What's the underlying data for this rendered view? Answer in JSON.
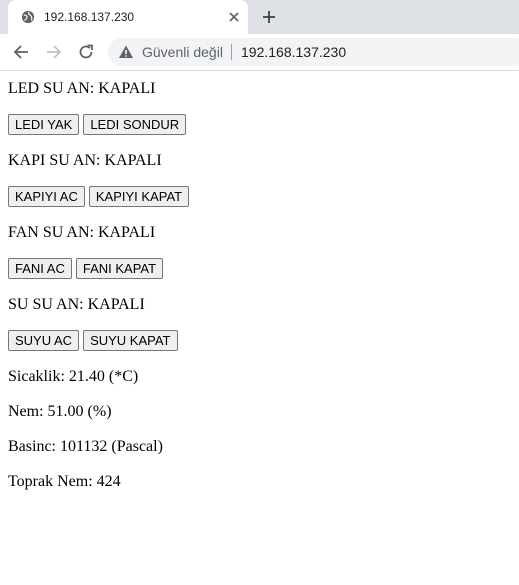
{
  "browser": {
    "tab_title": "192.168.137.230",
    "security_label": "Güvenli değil",
    "url": "192.168.137.230",
    "icons": [
      "globe-icon",
      "close-icon",
      "plus-icon",
      "back-arrow-icon",
      "forward-arrow-icon",
      "reload-icon",
      "warning-icon"
    ]
  },
  "page": {
    "led_status": "LED SU AN: KAPALI",
    "led_on": "LEDI YAK",
    "led_off": "LEDI SONDUR",
    "door_status": "KAPI SU AN: KAPALI",
    "door_open": "KAPIYI AC",
    "door_close": "KAPIYI KAPAT",
    "fan_status": "FAN SU AN: KAPALI",
    "fan_on": "FANI AC",
    "fan_off": "FANI KAPAT",
    "water_status": "SU SU AN: KAPALI",
    "water_on": "SUYU AC",
    "water_off": "SUYU KAPAT",
    "temperature": "Sicaklik: 21.40 (*C)",
    "humidity": "Nem: 51.00 (%)",
    "pressure": "Basinc: 101132 (Pascal)",
    "soil_moisture": "Toprak Nem: 424"
  }
}
